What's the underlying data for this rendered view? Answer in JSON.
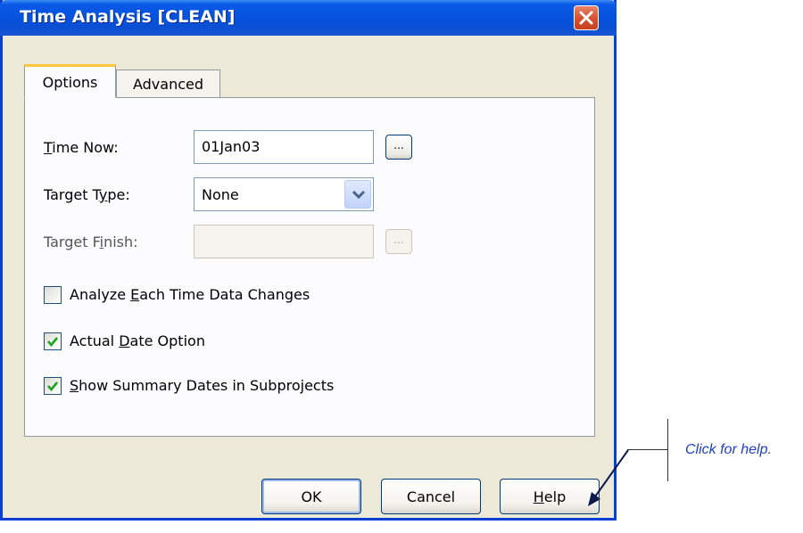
{
  "window": {
    "title": "Time Analysis [CLEAN]"
  },
  "tabs": [
    {
      "label": "Options",
      "selected": true
    },
    {
      "label": "Advanced",
      "selected": false
    }
  ],
  "fields": {
    "time_now": {
      "label_pre": "",
      "label_u": "T",
      "label_post": "ime Now:",
      "value": "01Jan03"
    },
    "target_type": {
      "label_pre": "Target T",
      "label_u": "y",
      "label_post": "pe:",
      "value": "None"
    },
    "target_finish": {
      "label_pre": "Target F",
      "label_u": "i",
      "label_post": "nish:",
      "value": ""
    }
  },
  "browse_label": "...",
  "checkboxes": [
    {
      "pre": "Analyze ",
      "u": "E",
      "post": "ach Time Data Changes",
      "checked": false
    },
    {
      "pre": "Actual ",
      "u": "D",
      "post": "ate Option",
      "checked": true
    },
    {
      "pre": "",
      "u": "S",
      "post": "how Summary Dates in Subprojects",
      "checked": true
    }
  ],
  "buttons": {
    "ok": "OK",
    "cancel": "Cancel",
    "help_u": "H",
    "help_post": "elp"
  },
  "annotation": {
    "text": "Click for help."
  },
  "colors": {
    "titlebar": "#0553de",
    "dialog_bg": "#ece9d8",
    "annotation": "#1f3fbf",
    "check": "#21a121"
  }
}
